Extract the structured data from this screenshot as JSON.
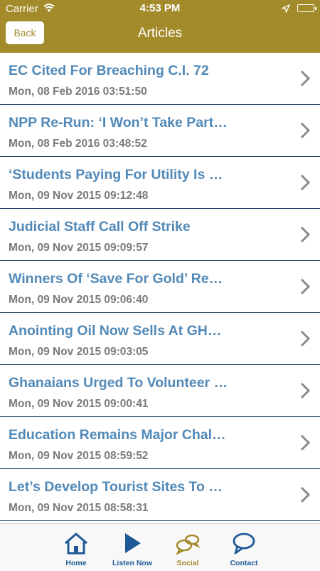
{
  "status_bar": {
    "carrier": "Carrier",
    "time": "4:53 PM"
  },
  "nav": {
    "back_label": "Back",
    "title": "Articles"
  },
  "articles": [
    {
      "title": "EC Cited For Breaching C.I. 72",
      "date": "Mon, 08 Feb 2016 03:51:50"
    },
    {
      "title": "NPP Re-Run: ‘I Won’t Take Part…",
      "date": "Mon, 08 Feb 2016 03:48:52"
    },
    {
      "title": "‘Students Paying For Utility Is …",
      "date": "Mon, 09 Nov 2015 09:12:48"
    },
    {
      "title": "Judicial Staff Call Off Strike",
      "date": "Mon, 09 Nov 2015 09:09:57"
    },
    {
      "title": "Winners Of ‘Save For Gold’ Re…",
      "date": "Mon, 09 Nov 2015 09:06:40"
    },
    {
      "title": "Anointing Oil Now Sells At GH…",
      "date": "Mon, 09 Nov 2015 09:03:05"
    },
    {
      "title": "Ghanaians Urged To Volunteer …",
      "date": "Mon, 09 Nov 2015 09:00:41"
    },
    {
      "title": "Education Remains Major Chal…",
      "date": "Mon, 09 Nov 2015 08:59:52"
    },
    {
      "title": "Let’s Develop Tourist Sites To …",
      "date": "Mon, 09 Nov 2015 08:58:31"
    }
  ],
  "tabs": [
    {
      "label": "Home",
      "icon": "home-icon"
    },
    {
      "label": "Listen Now",
      "icon": "play-icon"
    },
    {
      "label": "Social",
      "icon": "chat-bubbles-icon"
    },
    {
      "label": "Contact",
      "icon": "speech-bubble-icon"
    }
  ],
  "colors": {
    "header": "#a38b2c",
    "title_text": "#5189b8",
    "date_text": "#7a7a7a",
    "divider": "#1e3f66",
    "tab_icon": "#1e5a96",
    "tab_active": "#a38b2c"
  }
}
